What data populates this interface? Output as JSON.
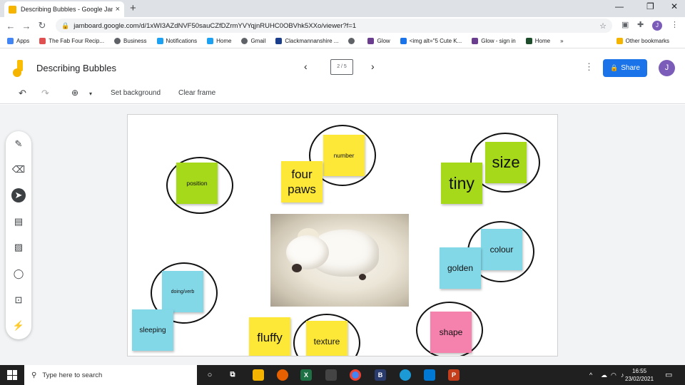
{
  "browser": {
    "tab_title": "Describing Bubbles - Google Jam",
    "tab_close": "×",
    "new_tab": "+",
    "url": "jamboard.google.com/d/1xWI3AZdNVF50sauCZfDZrmYVYqjnRUHC0OBVhk5XXo/viewer?f=1",
    "window_controls": [
      "—",
      "❐",
      "✕"
    ]
  },
  "bookmarks": [
    {
      "label": "Apps",
      "color": "#4285f4"
    },
    {
      "label": "The Fab Four Recip...",
      "color": "#e05050"
    },
    {
      "label": "Business",
      "color": "#5f6368"
    },
    {
      "label": "Notifications",
      "color": "#1da1f2"
    },
    {
      "label": "Home",
      "color": "#1da1f2"
    },
    {
      "label": "Gmail",
      "color": "#5f6368"
    },
    {
      "label": "Clackmannanshire ...",
      "color": "#1a3e8c"
    },
    {
      "label": "",
      "color": "#5f6368"
    },
    {
      "label": "Glow",
      "color": "#6a3d8f"
    },
    {
      "label": "<img alt=\"5 Cute K...",
      "color": "#1a73e8"
    },
    {
      "label": "Glow - sign in",
      "color": "#6a3d8f"
    },
    {
      "label": "Home",
      "color": "#1e4d2b"
    }
  ],
  "bookmarks_more": "»",
  "bookmarks_other": "Other bookmarks",
  "jamboard": {
    "title": "Describing Bubbles",
    "frame_indicator": "2 / 5",
    "share_label": "Share",
    "avatar_initial": "J"
  },
  "toolbar": {
    "undo": "↶",
    "redo": "↷",
    "zoom": "⊕",
    "zoom_caret": "▾",
    "set_background": "Set background",
    "clear_frame": "Clear frame"
  },
  "side_tools": [
    "pen-icon",
    "eraser-icon",
    "select-icon",
    "sticky-note-icon",
    "image-icon",
    "circle-icon",
    "text-box-icon",
    "laser-icon"
  ],
  "notes": {
    "position": "position",
    "number": "number",
    "four_paws": "four paws",
    "size": "size",
    "tiny": "tiny",
    "colour": "colour",
    "golden": "golden",
    "doing_verb": "doing/verb",
    "sleeping": "sleeping",
    "fluffy": "fluffy",
    "texture": "texture",
    "shape": "shape"
  },
  "note_colors": {
    "green": "#a5d91a",
    "yellow": "#fde838",
    "blue": "#83d8e8",
    "pink": "#f582ad"
  },
  "taskbar": {
    "search_placeholder": "Type here to search",
    "time": "16:55",
    "date": "23/02/2021"
  }
}
